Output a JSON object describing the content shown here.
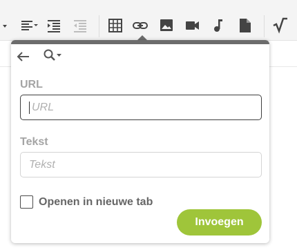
{
  "icons": {
    "list_dropdown": "caret-down-icon",
    "align": "align-left-dropdown-icon",
    "indent": "indent-icon",
    "outdent": "outdent-icon",
    "table": "table-icon",
    "link": "link-icon",
    "image": "image-icon",
    "video": "video-icon",
    "audio": "music-note-icon",
    "file": "file-icon",
    "formula": "square-root-icon",
    "back": "arrow-left-icon",
    "search": "search-dropdown-icon"
  },
  "link_popup": {
    "url_label": "URL",
    "url_placeholder": "URL",
    "text_label": "Tekst",
    "text_placeholder": "Tekst",
    "open_new_tab_label": "Openen in nieuwe tab",
    "open_new_tab_checked": false,
    "insert_button": "Invoegen"
  },
  "colors": {
    "toolbar_bg": "#f4f4f4",
    "icon": "#444444",
    "accent_button": "#9fc53a",
    "popup_top_bar": "#6c6c6c"
  }
}
